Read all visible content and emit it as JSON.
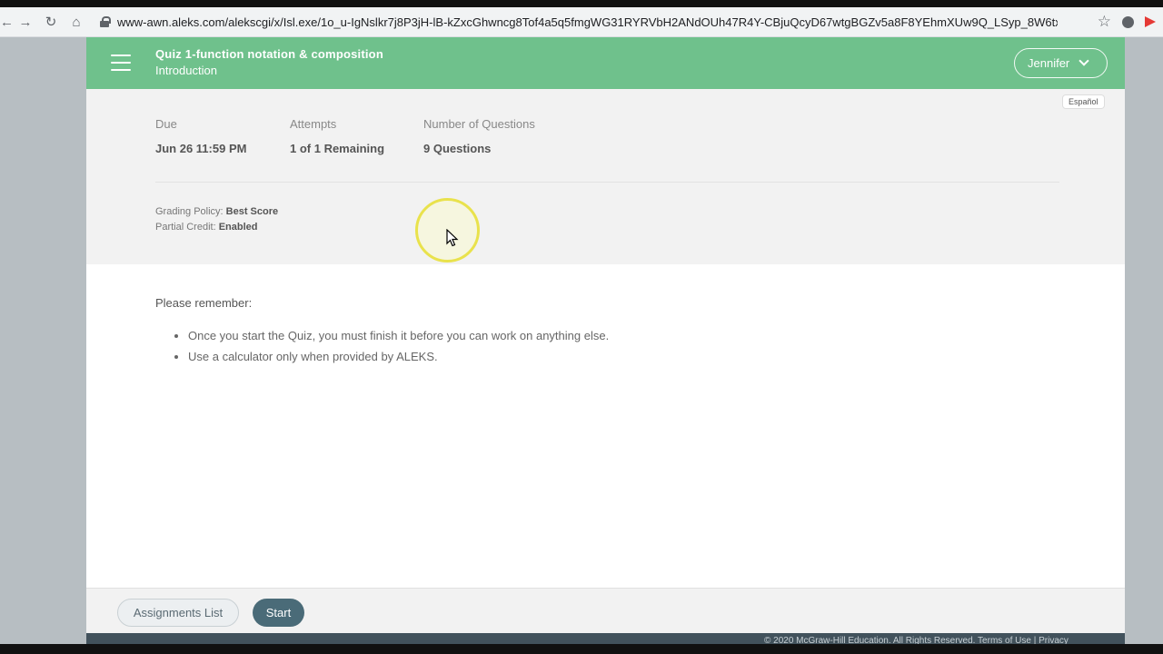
{
  "browser": {
    "url": "www-awn.aleks.com/alekscgi/x/Isl.exe/1o_u-IgNslkr7j8P3jH-lB-kZxcGhwncg8Tof4a5q5fmgWG31RYRVbH2ANdOUh47R4Y-CBjuQcyD67wtgBGZv5a8F8YEhmXUw9Q_LSyp_8W6txxG9cq?1oB...",
    "icons": [
      "back-arrow-icon",
      "forward-arrow-icon",
      "reload-icon",
      "home-icon",
      "lock-icon",
      "star-icon",
      "extension-icon"
    ]
  },
  "header": {
    "title": "Quiz 1-function notation & composition",
    "subtitle": "Introduction",
    "user_name": "Jennifer",
    "bg_color": "#6fc18c"
  },
  "info": {
    "language_link": "Español",
    "due": {
      "label": "Due",
      "value": "Jun 26 11:59 PM"
    },
    "attempts": {
      "label": "Attempts",
      "value": "1 of 1 Remaining"
    },
    "questions": {
      "label": "Number of Questions",
      "value": "9 Questions"
    },
    "grading_label": "Grading Policy:",
    "grading_value": "Best Score",
    "credit_label": "Partial Credit:",
    "credit_value": "Enabled"
  },
  "remember": {
    "heading": "Please remember:",
    "items": [
      "Once you start the Quiz, you must finish it before you can work on anything else.",
      "Use a calculator only when provided by ALEKS."
    ]
  },
  "footer": {
    "assignments_label": "Assignments List",
    "start_label": "Start",
    "copyright": "© 2020 McGraw-Hill Education. All Rights Reserved.    Terms of Use   |   Privacy"
  }
}
